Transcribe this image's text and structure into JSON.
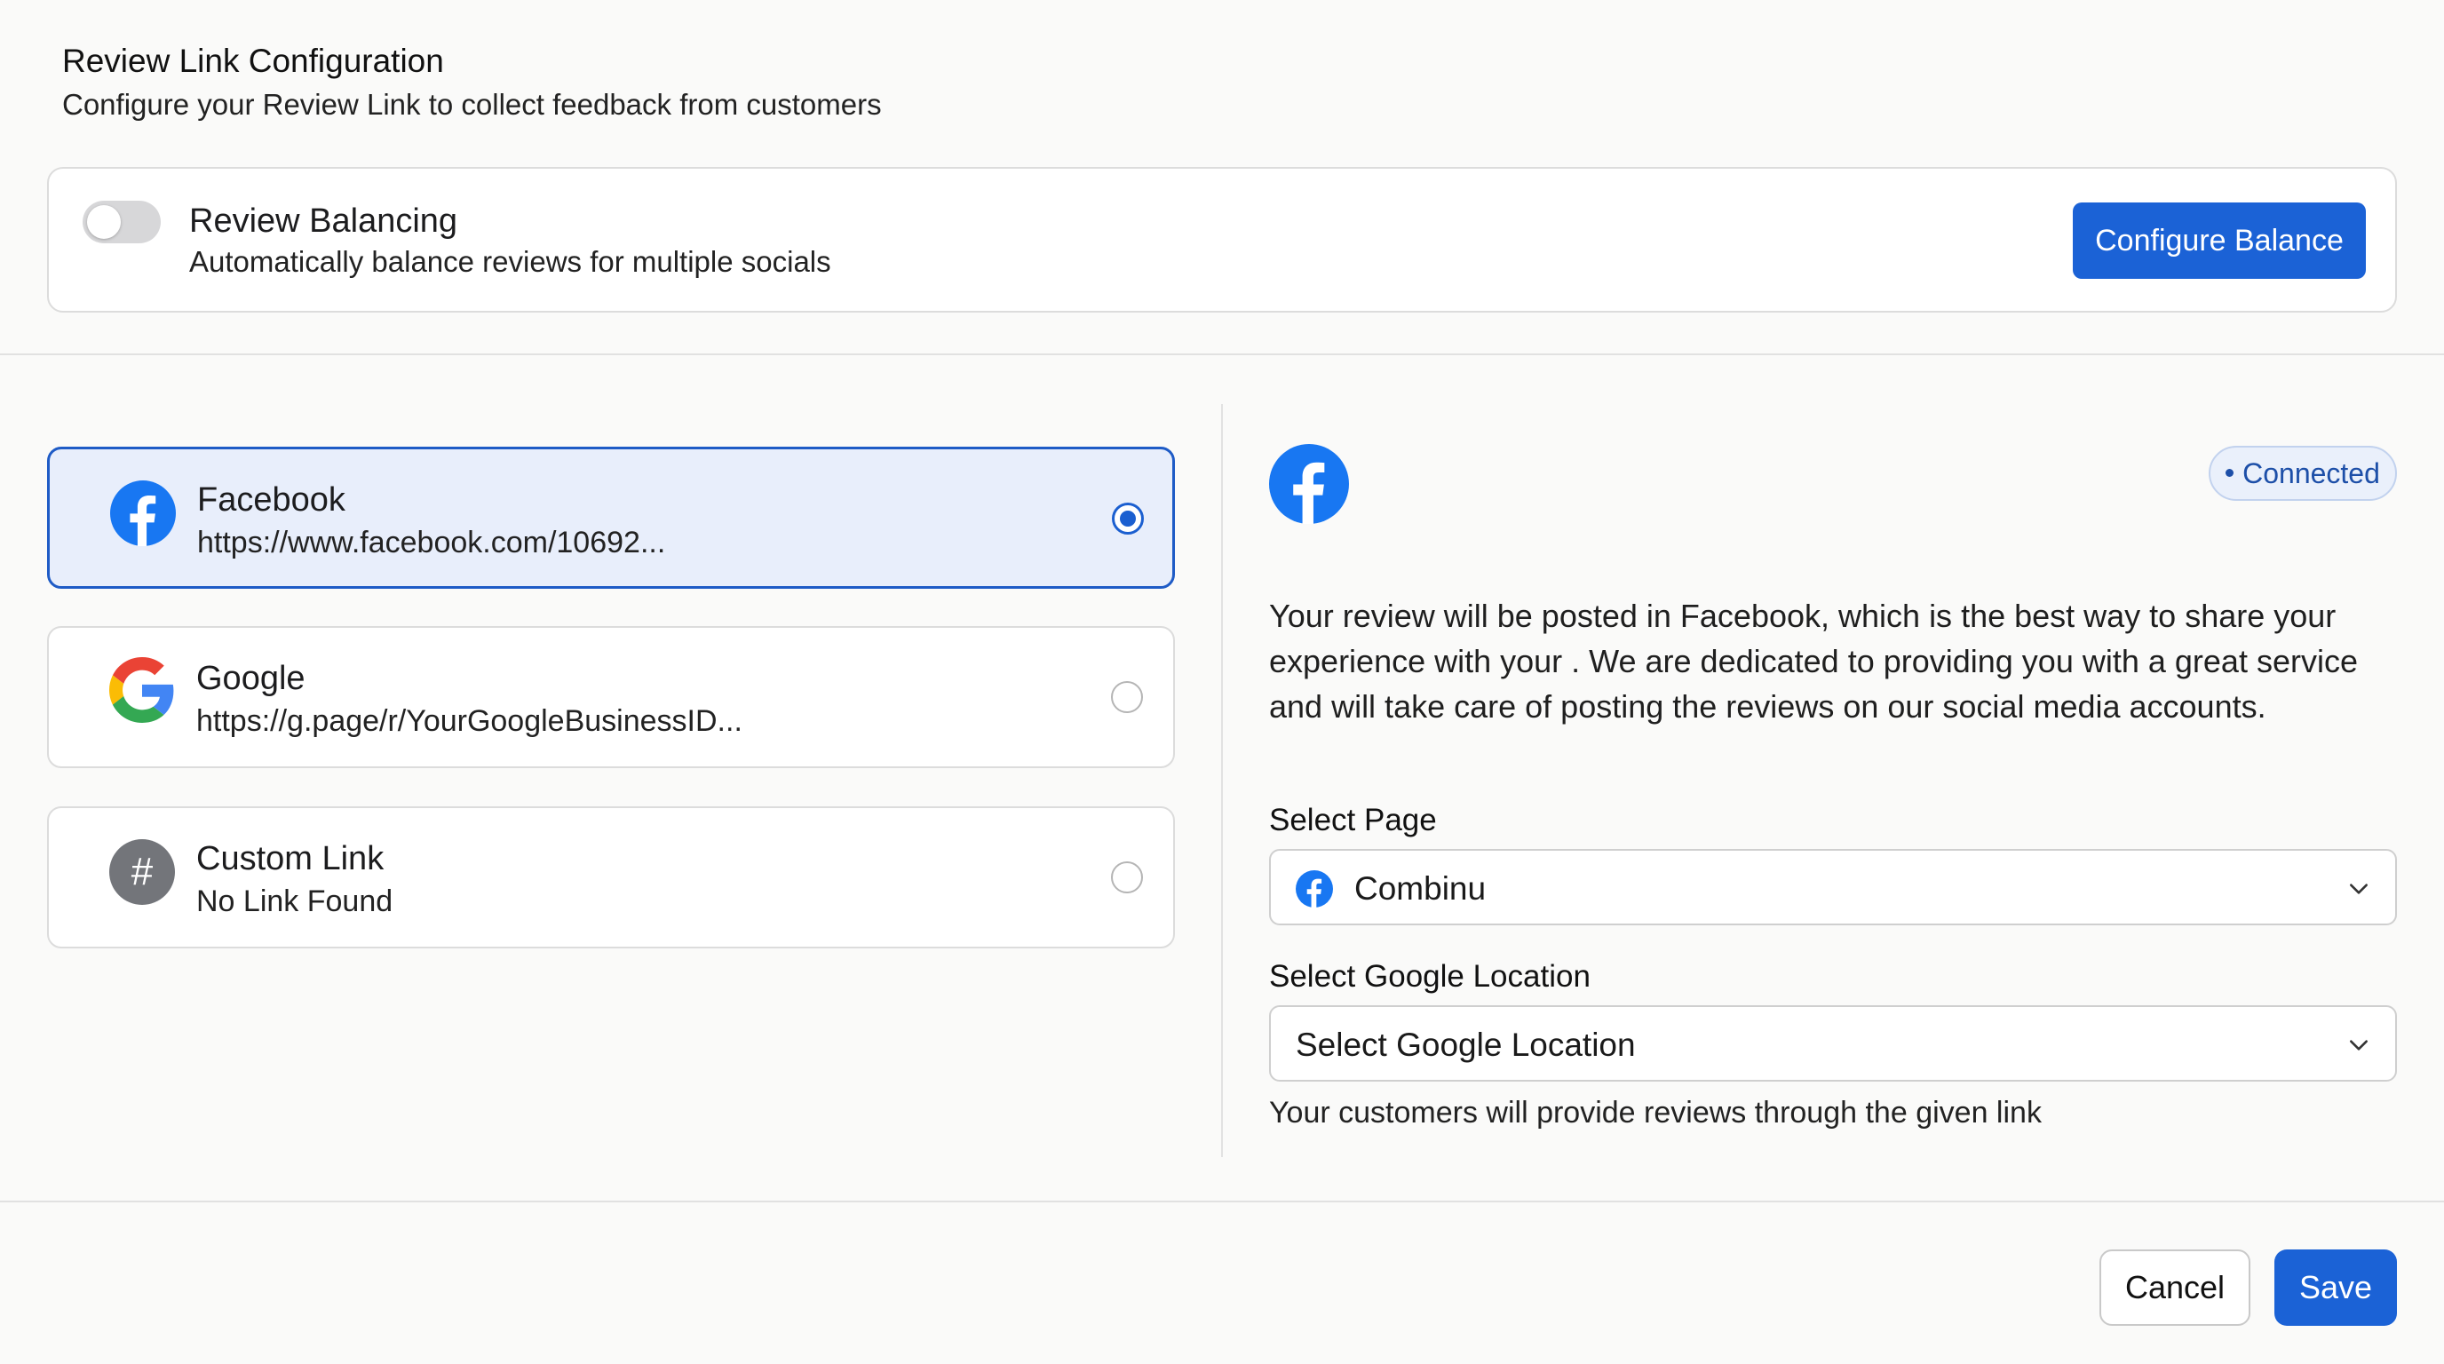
{
  "header": {
    "title": "Review Link Configuration",
    "subtitle": "Configure your Review Link to collect feedback from customers"
  },
  "balancing": {
    "enabled": false,
    "title": "Review Balancing",
    "description": "Automatically balance reviews for multiple socials",
    "button_label": "Configure Balance"
  },
  "options": [
    {
      "name": "Facebook",
      "link": "https://www.facebook.com/10692...",
      "icon": "facebook-icon",
      "selected": true
    },
    {
      "name": "Google",
      "link": "https://g.page/r/YourGoogleBusinessID...",
      "icon": "google-icon",
      "selected": false
    },
    {
      "name": "Custom Link",
      "link": "No Link Found",
      "icon": "hash-icon",
      "icon_glyph": "#",
      "selected": false
    }
  ],
  "detail": {
    "platform_icon": "facebook-icon",
    "status": "Connected",
    "description": "Your review will be posted in Facebook, which is the best way to share your experience with your . We are dedicated to providing you with a great service and will take care of posting the reviews on our social media accounts.",
    "select_page": {
      "label": "Select Page",
      "value": "Combinu"
    },
    "select_location": {
      "label": "Select Google Location",
      "placeholder": "Select Google Location"
    },
    "hint": "Your customers will provide reviews through the given link"
  },
  "footer": {
    "cancel_label": "Cancel",
    "save_label": "Save"
  },
  "colors": {
    "primary": "#1b62d6",
    "facebook": "#1877f2",
    "selected_bg": "#e8eefb",
    "badge_text": "#1d4fa8"
  }
}
